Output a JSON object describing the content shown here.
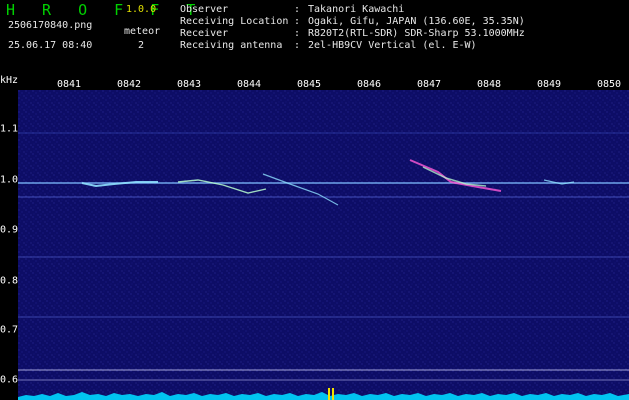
{
  "app": {
    "title": "H R O F F T",
    "version": "1.0.0",
    "file_name": "2506170840.png",
    "datetime": "25.06.17 08:40",
    "meteor_label": "meteor",
    "meteor_count": "2"
  },
  "info": [
    {
      "key": "Observer",
      "sep": ":",
      "value": "Takanori Kawachi"
    },
    {
      "key": "Receiving Location",
      "sep": ":",
      "value": "Ogaki, Gifu, JAPAN (136.60E, 35.35N)"
    },
    {
      "key": "Receiver",
      "sep": ":",
      "value": "R820T2(RTL-SDR) SDR-Sharp 53.1000MHz"
    },
    {
      "key": "Receiving antenna",
      "sep": ":",
      "value": "2el-HB9CV Vertical (el. E-W)"
    }
  ],
  "spectrogram": {
    "unit": "kHz",
    "time_labels": [
      "0841",
      "0842",
      "0843",
      "0844",
      "0845",
      "0846",
      "0847",
      "0848",
      "0849",
      "0850"
    ],
    "freq_labels": [
      "1.1",
      "1.0",
      "0.9",
      "0.8",
      "0.7",
      "0.6"
    ],
    "colors": {
      "background": "#101070",
      "carrier": "#7fbfff",
      "meteor": "#ff5ad8",
      "noise_floor": "#00d8ff",
      "marker": "#f2e200"
    }
  }
}
